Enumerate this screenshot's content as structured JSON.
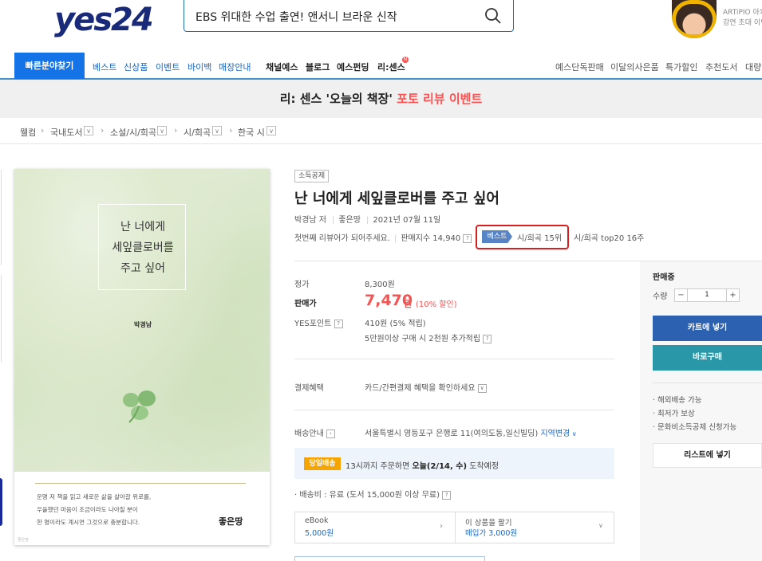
{
  "header": {
    "logo": "yes24",
    "search_value": "EBS 위대한 수업 출연! 앤서니 브라운 신작",
    "ad_line1": "ARTiPIO 아키",
    "ad_line2": "강연 초대 이벤"
  },
  "nav": {
    "quick": "빠른분야찾기",
    "primary": [
      "베스트",
      "신상품",
      "이벤트",
      "바이백",
      "매장안내"
    ],
    "secondary": [
      "채널예스",
      "블로그",
      "예스펀딩",
      "리:센스"
    ],
    "new_badge": "N",
    "right": [
      "예스단독판매",
      "이달의사은품",
      "특가할인",
      "추천도서",
      "대량"
    ]
  },
  "banner": {
    "prefix": "리: 센스 '오늘의 책장'",
    "highlight": "포토 리뷰 이벤트"
  },
  "breadcrumb": [
    "웰컴",
    "국내도서",
    "소설/시/희곡",
    "시/희곡",
    "한국 시"
  ],
  "cover": {
    "title": "난 너에게\n세잎클로버를\n주고 싶어",
    "author": "박경남",
    "blurb": "운명 저 책을 읽고 새로운 삶을 살아갈 위로를,\n우울했던 마음이 조금이라도 나아질 분이\n한 명이라도 계시면 그것으로 충분합니다.",
    "publisher": "좋은땅",
    "tiny": "좋은땅"
  },
  "product": {
    "badge": "소득공제",
    "title": "난 너에게 세잎클로버를 주고 싶어",
    "author": "박경남 저",
    "publisher": "좋은땅",
    "date": "2021년 07월 11일",
    "review_prompt": "첫번째 리뷰어가 되어주세요.",
    "sales_index": "판매지수 14,940",
    "best_tag": "베스트",
    "rank": "시/희곡 15위",
    "rank_top": "시/희곡 top20 16주"
  },
  "price": {
    "list_label": "정가",
    "list_value": "8,300원",
    "sale_label": "판매가",
    "sale_value": "7,470",
    "sale_unit": "원",
    "discount": "(10% 할인)",
    "point_label": "YES포인트",
    "point_value": "410원 (5% 적립)",
    "point_extra": "5만원이상 구매 시 2천원 추가적립"
  },
  "payment": {
    "label": "결제혜택",
    "value": "카드/간편결제 혜택을 확인하세요"
  },
  "shipping": {
    "label": "배송안내",
    "address": "서울특별시 영등포구 은행로 11(여의도동,일신빌딩)",
    "change": "지역변경",
    "dawn_tag": "당일배송",
    "dawn_text_a": "13시까지 주문하면 ",
    "dawn_text_b": "오늘(2/14, 수)",
    "dawn_text_c": " 도착예정",
    "fee": "· 배송비 : 유료 (도서 15,000원 이상 무료)"
  },
  "ebook": {
    "label": "eBook",
    "price": "5,000원",
    "sell_label": "이 상품을 팔기",
    "sell_price": "매입가 3,000원"
  },
  "sidebar": {
    "status": "판매중",
    "qty_label": "수량",
    "qty_value": "1",
    "cart": "카트에 넣기",
    "buy": "바로구매",
    "benefits": [
      "· 해외배송 가능",
      "· 최저가 보상",
      "· 문화비소득공제 신청가능"
    ],
    "wish": "리스트에 넣기"
  },
  "colors": {
    "brand_blue": "#1473e6",
    "price_red": "#f35555",
    "highlight_box": "#d81e1e",
    "cart_button": "#2b61b0",
    "buy_button": "#2a97a8"
  }
}
